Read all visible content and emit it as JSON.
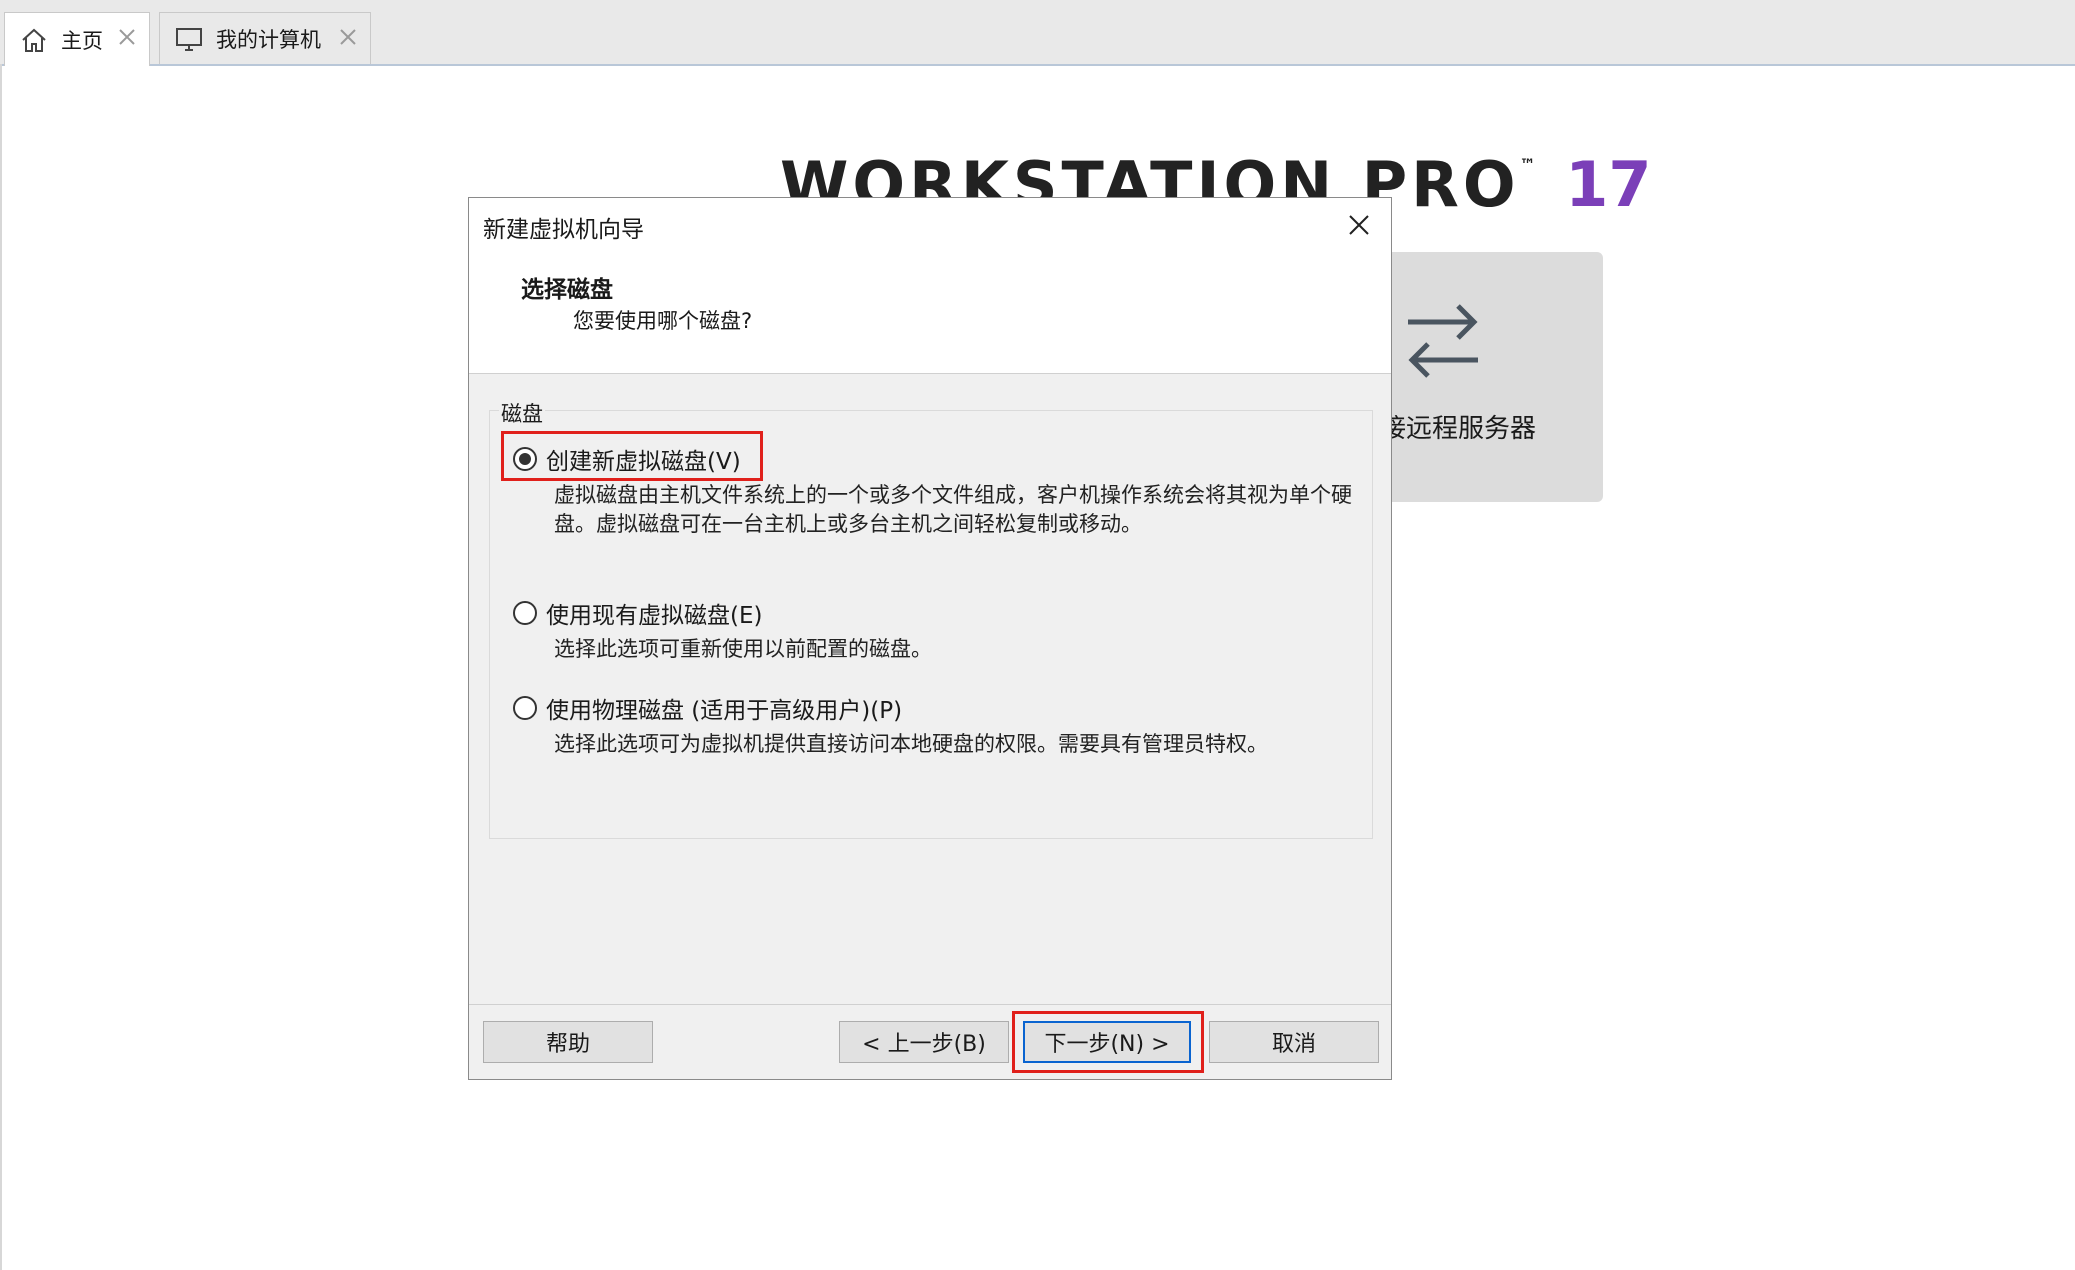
{
  "tabs": [
    {
      "label": "主页",
      "icon": "home-icon",
      "active": true
    },
    {
      "label": "我的计算机",
      "icon": "computer-icon",
      "active": false
    }
  ],
  "background": {
    "logo_text": "WORKSTATION PRO",
    "logo_tm": "™",
    "logo_version": "17",
    "remote_tile_label": "接远程服务器",
    "remote_tile_icon": "swap-arrows-icon"
  },
  "dialog": {
    "title": "新建虚拟机向导",
    "heading": "选择磁盘",
    "subheading": "您要使用哪个磁盘?",
    "group_label": "磁盘",
    "options": [
      {
        "label": "创建新虚拟磁盘(V)",
        "checked": true,
        "desc": "虚拟磁盘由主机文件系统上的一个或多个文件组成，客户机操作系统会将其视为单个硬盘。虚拟磁盘可在一台主机上或多台主机之间轻松复制或移动。"
      },
      {
        "label": "使用现有虚拟磁盘(E)",
        "checked": false,
        "desc": "选择此选项可重新使用以前配置的磁盘。"
      },
      {
        "label": "使用物理磁盘 (适用于高级用户)(P)",
        "checked": false,
        "desc": "选择此选项可为虚拟机提供直接访问本地硬盘的权限。需要具有管理员特权。"
      }
    ],
    "buttons": {
      "help": "帮助",
      "back": "< 上一步(B)",
      "next": "下一步(N) >",
      "cancel": "取消"
    }
  },
  "colors": {
    "highlight": "#e0201b",
    "logo_version": "#7b3fb8",
    "default_button_border": "#0a64d0"
  }
}
